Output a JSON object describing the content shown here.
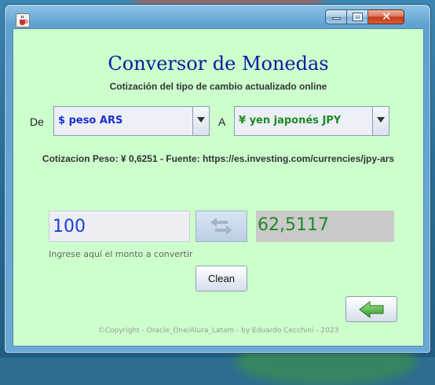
{
  "window": {
    "icon": "java-cup-icon",
    "controls": [
      "minimize-icon",
      "maximize-icon",
      "close-icon"
    ]
  },
  "app": {
    "title": "Conversor de Monedas",
    "subtitle": "Cotización del tipo de cambio actualizado online",
    "from_label": "De",
    "to_label": "A",
    "from_currency": "$ peso ARS",
    "to_currency": "¥ yen japonés JPY",
    "rate_text": "Cotizacion Peso: ¥ 0,6251 - Fuente: https://es.investing.com/currencies/jpy-ars",
    "amount_value": "100",
    "amount_hint": "Ingrese aquí el monto a convertir",
    "result_value": "62,5117",
    "clean_label": "Clean",
    "copyright": "©Copyright - Oracle_One/Alura_Latam  - by Eduardo Cecchini - 2023"
  },
  "colors": {
    "client_bg": "#ccffcc",
    "title": "#0a1aa0",
    "from_currency": "#1a2fd6",
    "to_currency": "#1f8a24",
    "amount": "#1a3fd0",
    "result": "#1f8a24"
  }
}
